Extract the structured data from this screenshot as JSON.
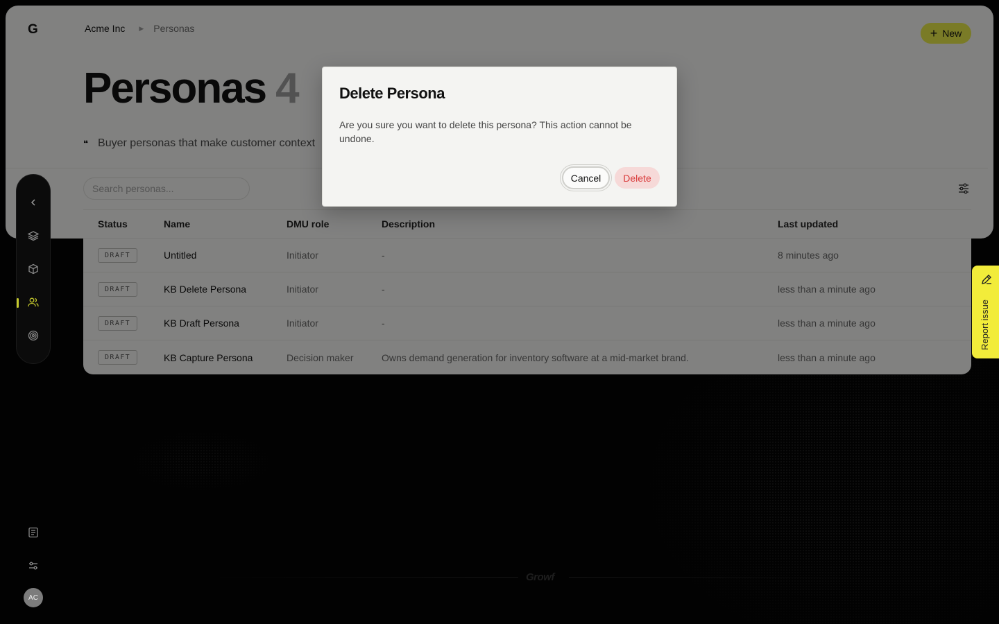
{
  "breadcrumb": {
    "org": "Acme Inc",
    "current": "Personas"
  },
  "header": {
    "new_label": "New",
    "title": "Personas",
    "count": "4",
    "subtitle": "Buyer personas that make customer context"
  },
  "search": {
    "placeholder": "Search personas..."
  },
  "table": {
    "columns": [
      "Status",
      "Name",
      "DMU role",
      "Description",
      "Last updated"
    ],
    "rows": [
      {
        "status": "DRAFT",
        "name": "Untitled",
        "role": "Initiator",
        "description": "-",
        "updated": "8 minutes ago"
      },
      {
        "status": "DRAFT",
        "name": "KB Delete Persona",
        "role": "Initiator",
        "description": "-",
        "updated": "less than a minute ago"
      },
      {
        "status": "DRAFT",
        "name": "KB Draft Persona",
        "role": "Initiator",
        "description": "-",
        "updated": "less than a minute ago"
      },
      {
        "status": "DRAFT",
        "name": "KB Capture Persona",
        "role": "Decision maker",
        "description": "Owns demand generation for inventory software at a mid-market brand.",
        "updated": "less than a minute ago"
      }
    ]
  },
  "modal": {
    "title": "Delete Persona",
    "body": "Are you sure you want to delete this persona? This action cannot be undone.",
    "cancel_label": "Cancel",
    "delete_label": "Delete"
  },
  "report": {
    "label": "Report issue"
  },
  "user": {
    "initials": "AC"
  },
  "footer": {
    "brand": "Growf"
  },
  "logo": {
    "mark": "G"
  },
  "colors": {
    "accent": "#e6e84a",
    "danger": "#d93b3b",
    "report_tab": "#f2ec3a"
  },
  "icons": [
    "collapse-chevron-icon",
    "layers-icon",
    "cube-icon",
    "users-icon",
    "target-icon",
    "document-icon",
    "settings-sliders-icon",
    "filter-icon",
    "pencil-icon"
  ]
}
